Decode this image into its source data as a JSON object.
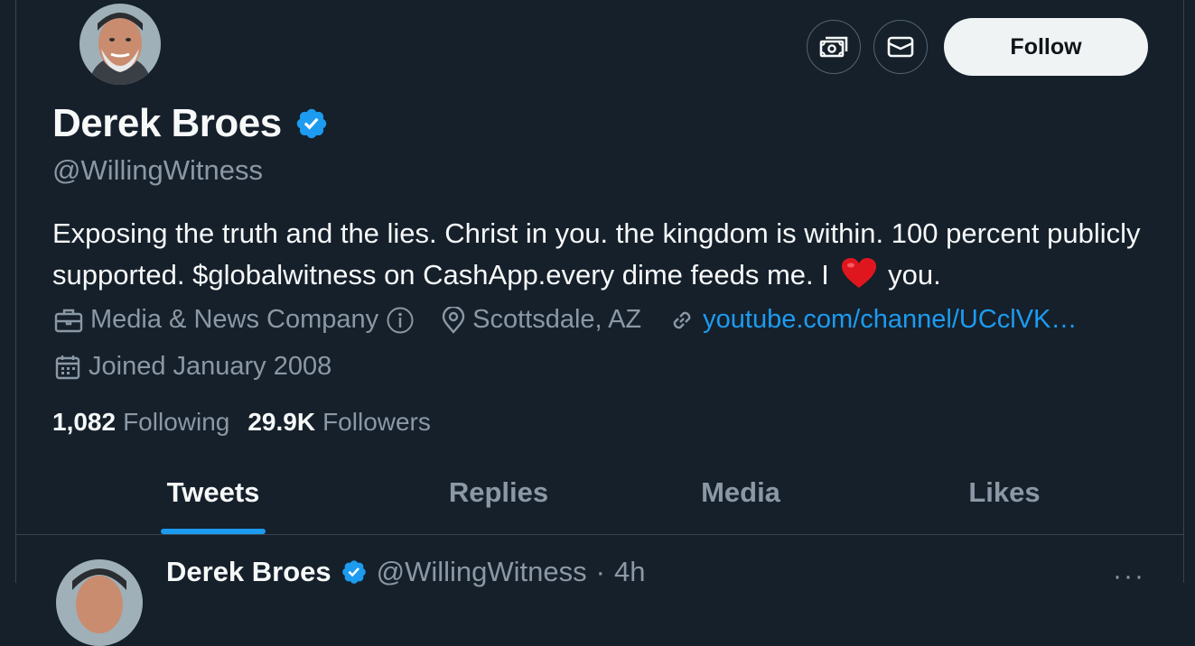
{
  "profile": {
    "display_name": "Derek Broes",
    "handle": "@WillingWitness",
    "bio_text": "Exposing the truth and the lies. Christ in you. the kingdom is within. 100 percent publicly supported. $globalwitness on CashApp.every dime feeds me. I",
    "bio_end": "you.",
    "bio_emoji": "red-heart",
    "category": "Media & News Company",
    "location": "Scottsdale, AZ",
    "website": "youtube.com/channel/UCclVK…",
    "joined": "Joined January 2008",
    "following_count": "1,082",
    "following_label": "Following",
    "followers_count": "29.9K",
    "followers_label": "Followers"
  },
  "actions": {
    "tip_icon": "money-icon",
    "message_icon": "mail-icon",
    "follow_label": "Follow"
  },
  "tabs": [
    {
      "label": "Tweets",
      "active": true
    },
    {
      "label": "Replies",
      "active": false
    },
    {
      "label": "Media",
      "active": false
    },
    {
      "label": "Likes",
      "active": false
    }
  ],
  "tweet": {
    "name": "Derek Broes",
    "handle": "@WillingWitness",
    "separator": "·",
    "time": "4h",
    "more": "···"
  },
  "colors": {
    "background": "#15202b",
    "accent": "#1d9bf0",
    "muted": "#8b98a5",
    "text": "#f7f9f9"
  }
}
